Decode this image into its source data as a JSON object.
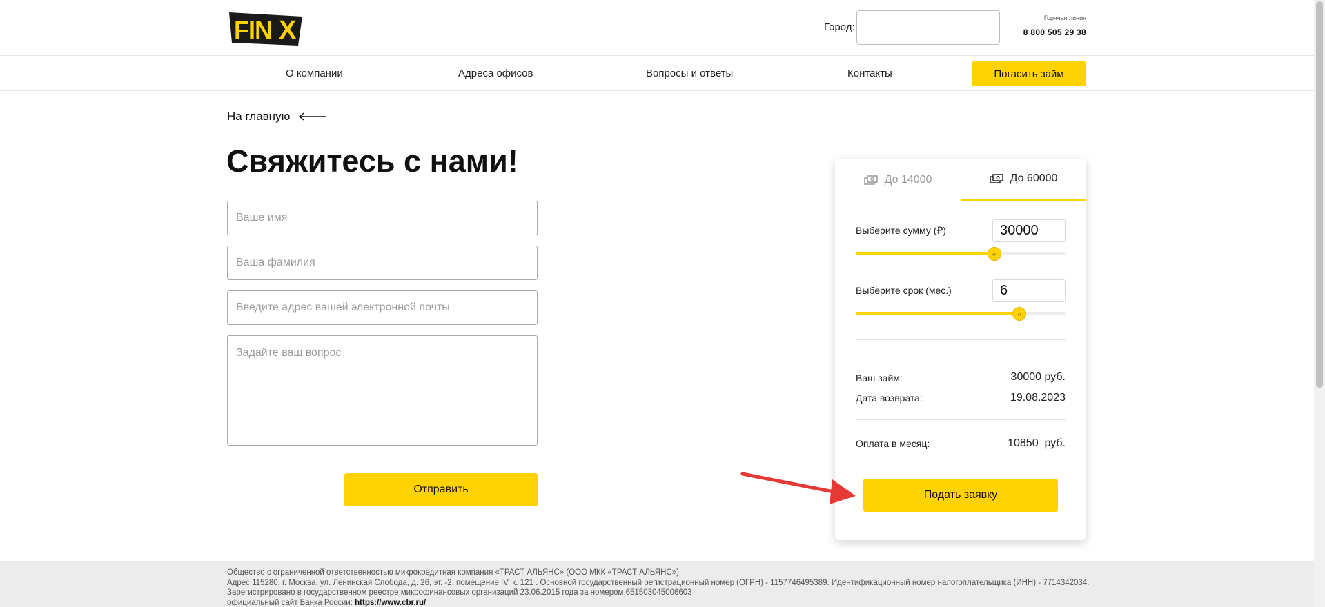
{
  "header": {
    "logo_text": "FIN X",
    "city_label": "Город:",
    "city_value": "",
    "hotline_label": "Горячая линия",
    "hotline_phone": "8 800 505 29 38"
  },
  "nav": {
    "items": [
      "О компании",
      "Адреса офисов",
      "Вопросы и ответы",
      "Контакты"
    ],
    "cta_label": "Погасить займ"
  },
  "back_link": "На главную",
  "page_title": "Свяжитесь с нами!",
  "form": {
    "name_placeholder": "Ваше имя",
    "surname_placeholder": "Ваша фамилия",
    "email_placeholder": "Введите адрес вашей электронной почты",
    "question_placeholder": "Задайте ваш вопрос",
    "submit_label": "Отправить"
  },
  "calculator": {
    "tabs": [
      {
        "label": "До 14000",
        "icon": "cash-icon",
        "active": false
      },
      {
        "label": "До 60000",
        "icon": "cash-icon",
        "active": true
      }
    ],
    "sum_label": "Выберите сумму (₽)",
    "sum_value": "30000",
    "sum_fraction": 0.66,
    "term_label": "Выберите срок (мес.)",
    "term_value": "6",
    "term_fraction": 0.78,
    "loan_label": "Ваш займ:",
    "loan_value": "30000 руб.",
    "return_label": "Дата возврата:",
    "return_value": "19.08.2023",
    "monthly_label": "Оплата в месяц:",
    "monthly_value": "10850  руб.",
    "apply_label": "Подать заявку",
    "accent_color": "#ffd200"
  },
  "annotation": {
    "arrow_color": "#e53935",
    "target": "apply-button"
  },
  "footer": {
    "line1": "Общество с ограниченной ответственностью микрокредитная компания «ТРАСТ АЛЬЯНС» (ООО МКК «ТРАСТ АЛЬЯНС»)",
    "line2": "Адрес 115280, г. Москва, ул. Ленинская Слобода, д. 26, эт. -2, помещение IV, к. 121 . Основной государственный регистрационный номер (ОГРН) - 1157746495389. Идентификационный номер налогоплательщика (ИНН) - 7714342034. Зарегистрировано в государственном реестре микрофинансовых организаций 23.06.2015 года за номером 651503045006603",
    "cbr_prefix": "официальный сайт Банка России:",
    "cbr_link": "https://www.cbr.ru/"
  }
}
